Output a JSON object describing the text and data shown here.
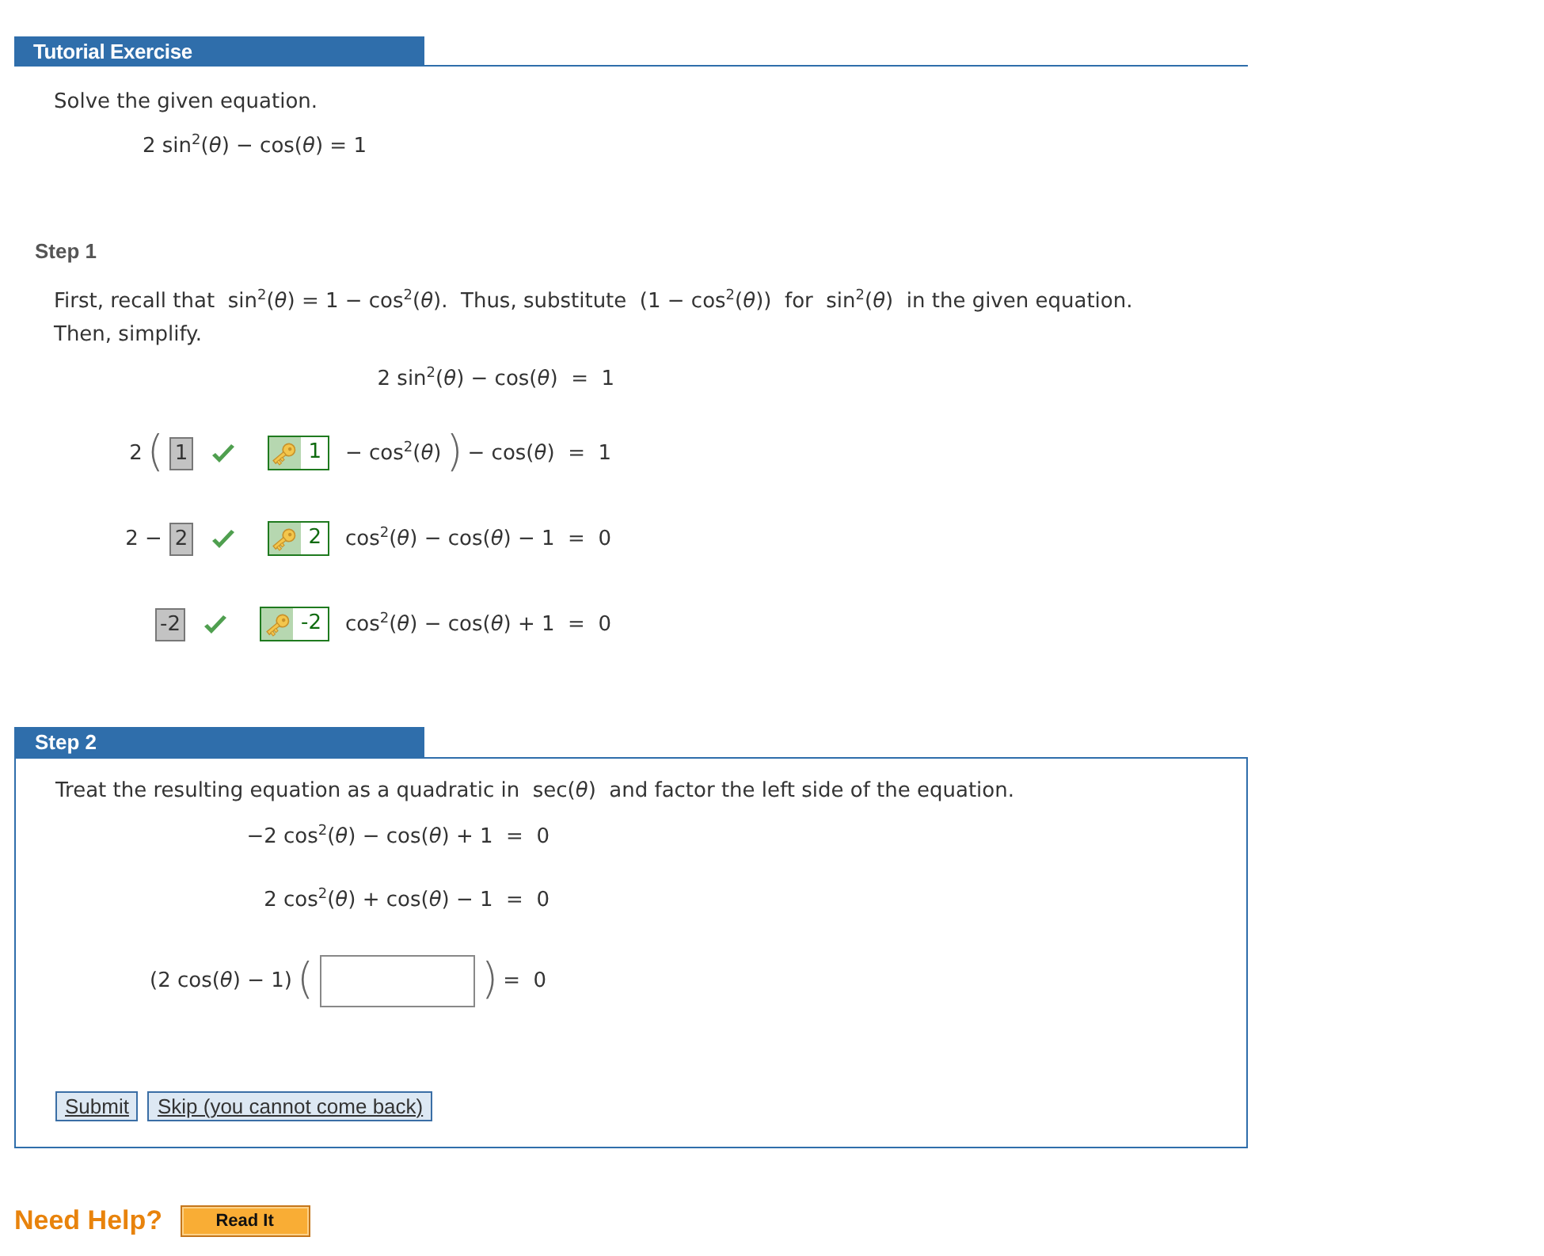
{
  "header": {
    "title": "Tutorial Exercise"
  },
  "problem": {
    "prompt": "Solve the given equation.",
    "equation": "2 sin$^{2}$(*θ*) − cos(*θ*) = 1"
  },
  "steps": [
    {
      "label": "Step 1",
      "active": false,
      "text": "First, recall that  sin$^{2}$(*θ*) = 1 − cos$^{2}$(*θ*).  Thus, substitute  (1 − cos$^{2}$(*θ*))  for  sin$^{2}$(*θ*)  in the given equation. Then, simplify.",
      "equations": [
        "2 sin$^{2}$(*θ*) − cos(*θ*)  =  1"
      ],
      "lines": [
        {
          "parts": [
            {
              "kind": "text",
              "text": "2"
            },
            {
              "kind": "paren",
              "text": "("
            },
            {
              "kind": "answer",
              "value": "1",
              "correct": true
            },
            {
              "kind": "key",
              "value": "1"
            },
            {
              "kind": "text",
              "text": "− cos$^{2}$(*θ*)"
            },
            {
              "kind": "paren",
              "text": ")"
            },
            {
              "kind": "text",
              "text": "− cos(*θ*)  =  1"
            }
          ]
        },
        {
          "parts": [
            {
              "kind": "text",
              "text": "2 −"
            },
            {
              "kind": "answer",
              "value": "2",
              "correct": true
            },
            {
              "kind": "key",
              "value": "2"
            },
            {
              "kind": "text",
              "text": "cos$^{2}$(*θ*) − cos(*θ*) − 1  =  0"
            }
          ]
        },
        {
          "parts": [
            {
              "kind": "answer",
              "value": "-2",
              "correct": true
            },
            {
              "kind": "key",
              "value": "-2"
            },
            {
              "kind": "text",
              "text": "cos$^{2}$(*θ*) − cos(*θ*) + 1  =  0"
            }
          ]
        }
      ]
    },
    {
      "label": "Step 2",
      "active": true,
      "text": "Treat the resulting equation as a quadratic in  sec(*θ*)  and factor the left side of the equation.",
      "equations": [
        "−2 cos$^{2}$(*θ*) − cos(*θ*) + 1  =  0",
        "2 cos$^{2}$(*θ*) + cos(*θ*) − 1  =  0"
      ],
      "lines": [
        {
          "parts": [
            {
              "kind": "text",
              "text": "(2 cos(*θ*) − 1)"
            },
            {
              "kind": "paren",
              "text": "("
            },
            {
              "kind": "input"
            },
            {
              "kind": "paren",
              "text": ")"
            },
            {
              "kind": "text",
              "text": "=  0"
            }
          ]
        }
      ],
      "buttons": [
        "Submit",
        "Skip (you cannot come back)"
      ]
    }
  ],
  "help": {
    "label": "Need Help?",
    "button": "Read It"
  }
}
